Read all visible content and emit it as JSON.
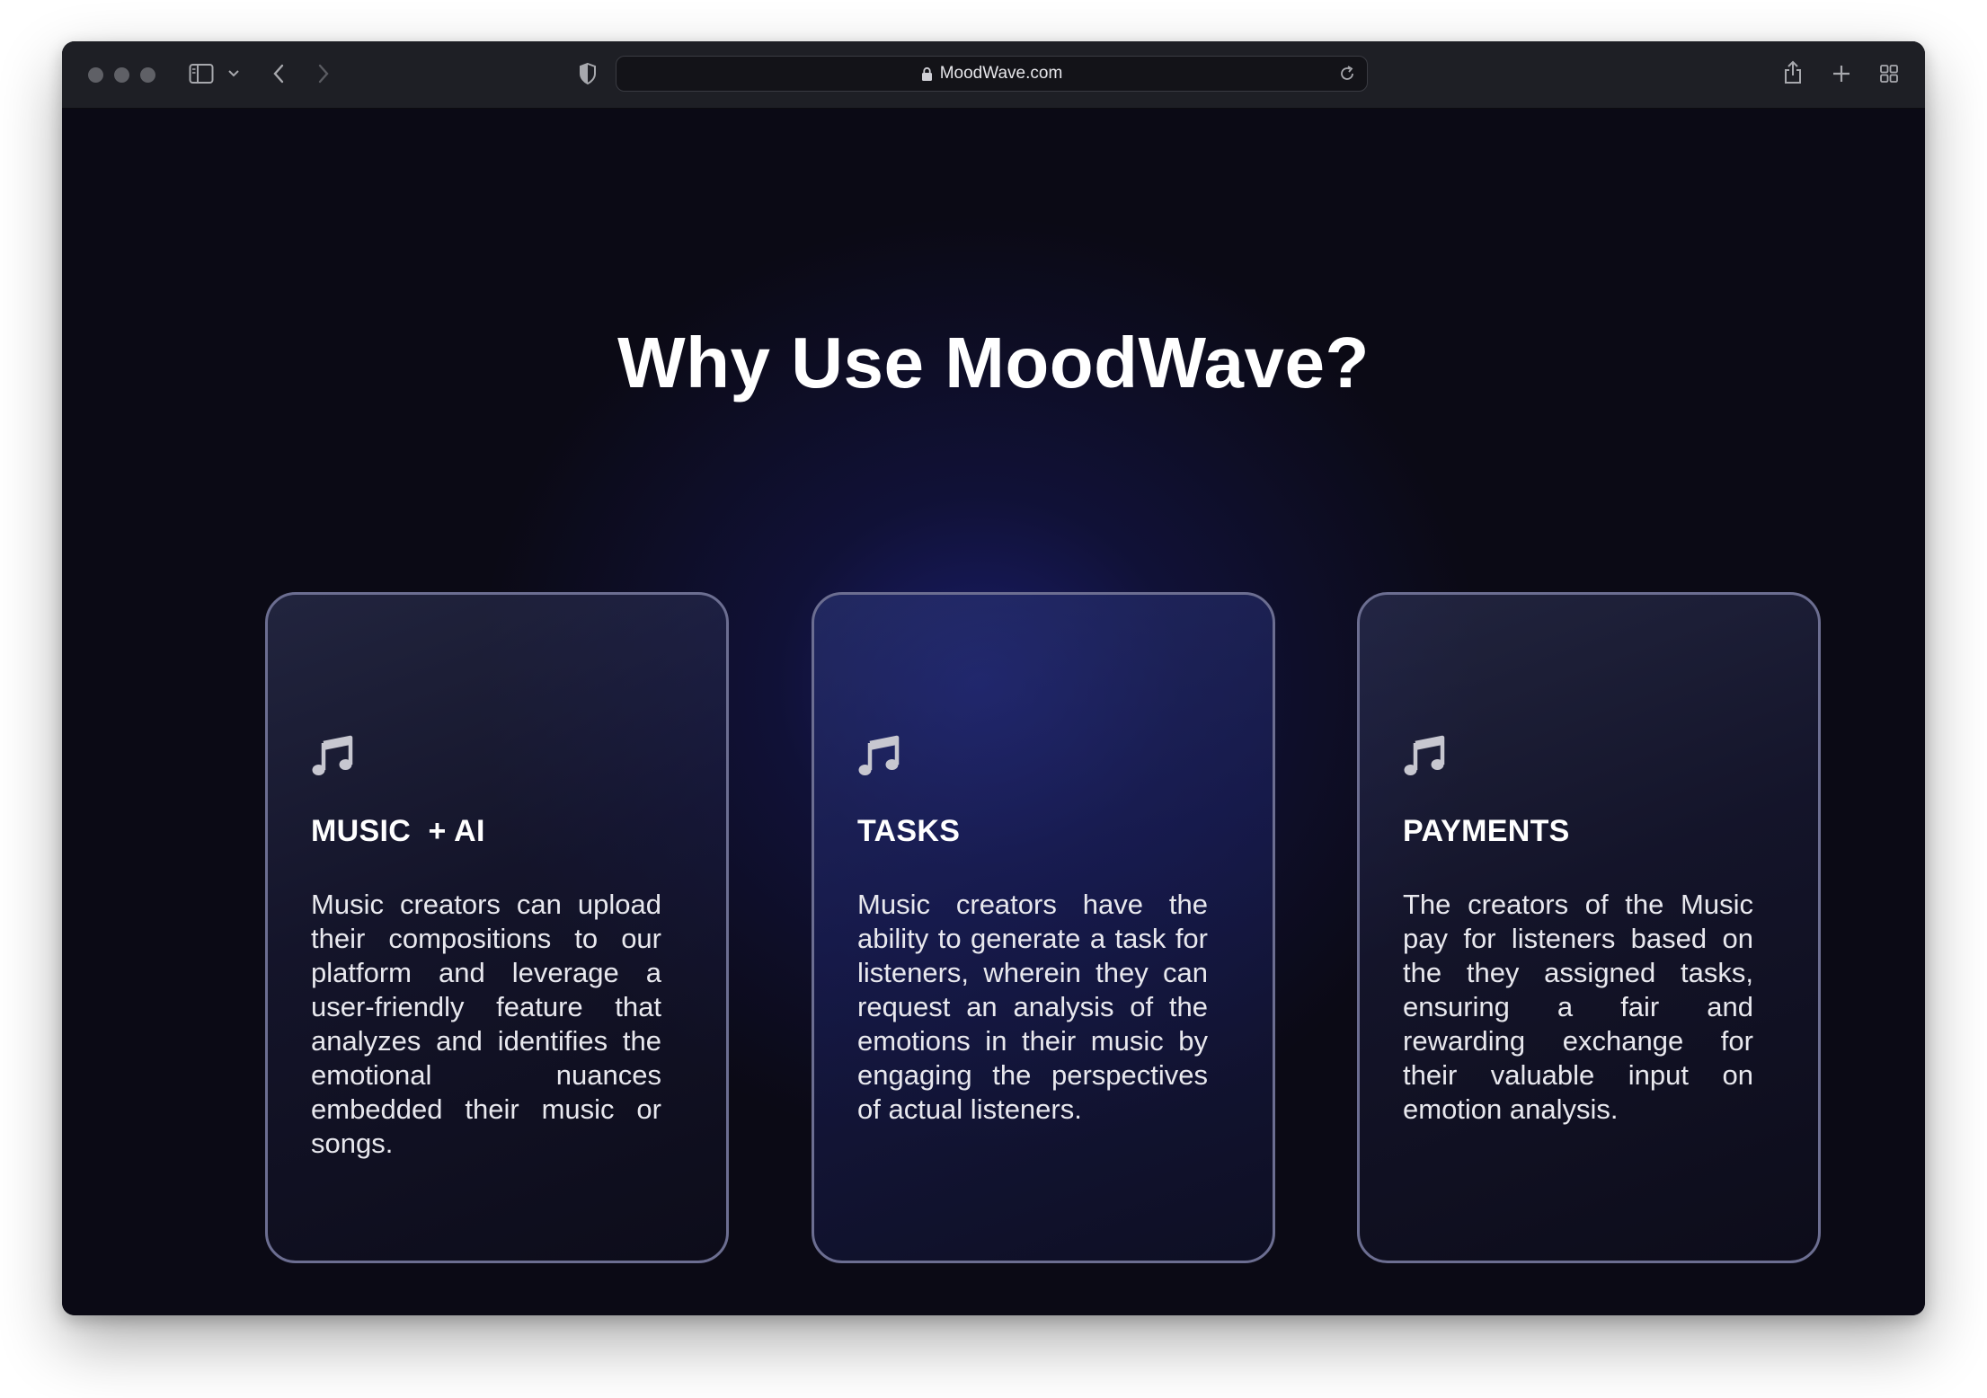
{
  "browser": {
    "url": "MoodWave.com"
  },
  "page": {
    "heading": "Why Use MoodWave?",
    "cards": [
      {
        "icon": "music-note-icon",
        "title": "MUSIC  + AI",
        "body": "Music creators can upload their compositions to our platform and leverage a user-friendly feature that analyzes and identifies the emotional nuances embedded their music or songs."
      },
      {
        "icon": "music-note-icon",
        "title": "TASKS",
        "body": "Music creators have the ability to generate a task for listeners, wherein they can request an analysis of the emotions in their music by engaging the perspectives of actual listeners."
      },
      {
        "icon": "music-note-icon",
        "title": "PAYMENTS",
        "body": "The creators of the Music pay for  listeners based on the they assigned tasks, ensuring a fair and rewarding exchange for their valuable input on emotion analysis."
      }
    ]
  },
  "colors": {
    "background": "#0b0a15",
    "card_border": "#6c6e91",
    "accent_glow": "#1a1e6e",
    "text": "#ffffff"
  }
}
